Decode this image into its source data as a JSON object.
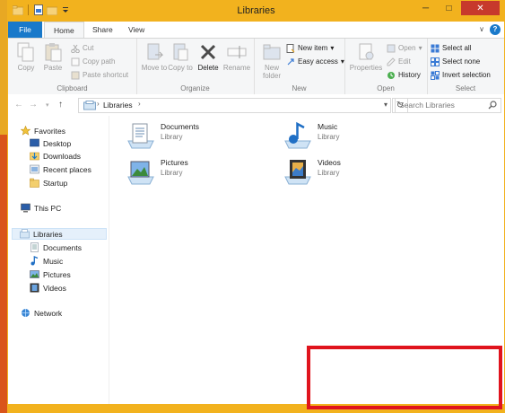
{
  "window": {
    "title": "Libraries"
  },
  "titlebar": {
    "minimize_glyph": "─",
    "maximize_glyph": "□",
    "close_glyph": "✕"
  },
  "tabs": {
    "file": "File",
    "home": "Home",
    "share": "Share",
    "view": "View",
    "help_glyph": "?"
  },
  "ribbon": {
    "clipboard": {
      "label": "Clipboard",
      "copy": "Copy",
      "paste": "Paste",
      "cut": "Cut",
      "copy_path": "Copy path",
      "paste_shortcut": "Paste shortcut"
    },
    "organize": {
      "label": "Organize",
      "move_to": "Move to",
      "copy_to": "Copy to",
      "delete": "Delete",
      "rename": "Rename"
    },
    "new": {
      "label": "New",
      "new_folder": "New folder",
      "new_item": "New item",
      "easy_access": "Easy access"
    },
    "open": {
      "label": "Open",
      "properties": "Properties",
      "open": "Open",
      "edit": "Edit",
      "history": "History"
    },
    "select": {
      "label": "Select",
      "select_all": "Select all",
      "select_none": "Select none",
      "invert_selection": "Invert selection"
    }
  },
  "address": {
    "path": "Libraries",
    "search_placeholder": "Search Libraries"
  },
  "nav": {
    "favorites": "Favorites",
    "desktop": "Desktop",
    "downloads": "Downloads",
    "recent_places": "Recent places",
    "startup": "Startup",
    "this_pc": "This PC",
    "libraries": "Libraries",
    "documents": "Documents",
    "music": "Music",
    "pictures": "Pictures",
    "videos": "Videos",
    "network": "Network"
  },
  "libraries": [
    {
      "name": "Documents",
      "type": "Library",
      "icon": "documents-library-icon"
    },
    {
      "name": "Music",
      "type": "Library",
      "icon": "music-library-icon"
    },
    {
      "name": "Pictures",
      "type": "Library",
      "icon": "pictures-library-icon"
    },
    {
      "name": "Videos",
      "type": "Library",
      "icon": "videos-library-icon"
    }
  ],
  "colors": {
    "frame": "#f2b21e",
    "file_tab": "#1979ca",
    "highlight_box": "#e0141d",
    "close_button": "#c7392c"
  }
}
